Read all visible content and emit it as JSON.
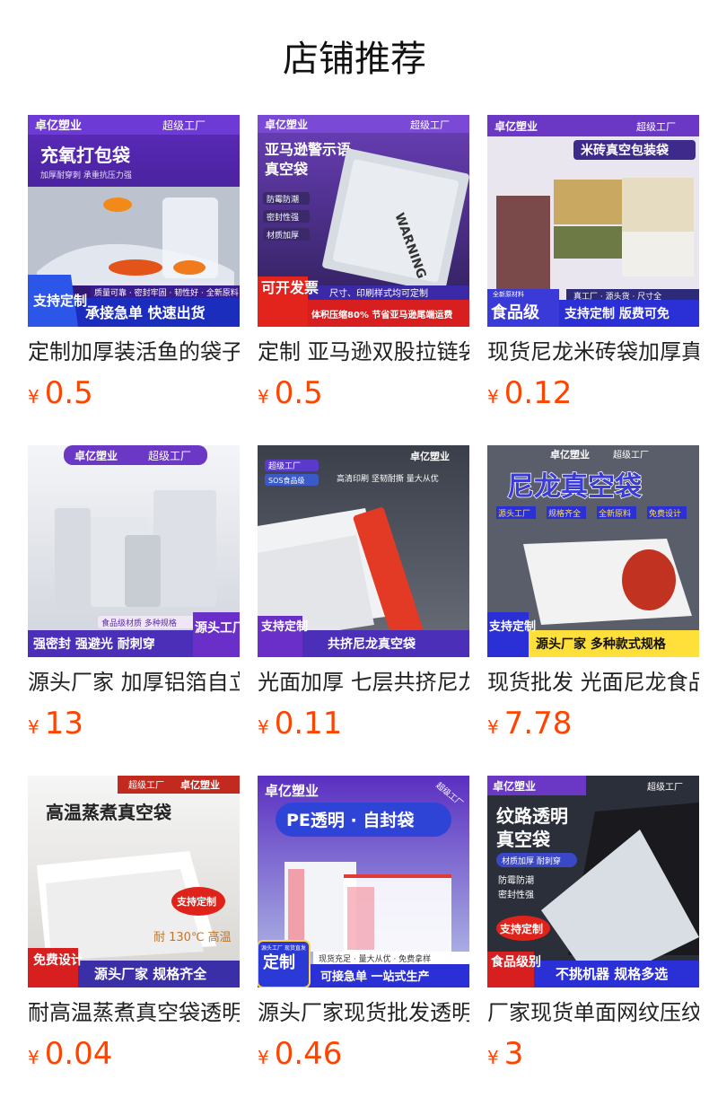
{
  "section": {
    "title": "店铺推荐"
  },
  "colors": {
    "price": "#ff4400",
    "title": "#111111",
    "name": "#222222",
    "banner_blue": "#2b2fd6",
    "banner_purple": "#6b2fc9",
    "badge_red": "#e0231a"
  },
  "products": [
    {
      "name": "定制加厚装活鱼的袋子",
      "currency": "¥",
      "price": "0.5",
      "image": {
        "brand": "卓亿塑业",
        "badge": "超级工厂",
        "headline": "充氧打包袋",
        "subline": "加厚耐穿刺 承重抗压力强",
        "features": "质量可靠 · 密封牢固 · 韧性好 · 全新原料",
        "stamp": "支持定制",
        "banner": "承接急单 快速出货"
      }
    },
    {
      "name": "定制 亚马逊双股拉链袋",
      "currency": "¥",
      "price": "0.5",
      "image": {
        "brand": "卓亿塑业",
        "badge": "超级工厂",
        "headline": "亚马逊警示语",
        "headline2": "真空袋",
        "tags": [
          "防霉防潮",
          "密封性强",
          "材质加厚"
        ],
        "bag_text": "WARNING",
        "note": "尺寸、印刷样式均可定制",
        "stamp": "可开发票",
        "banner": "体积压缩80% 节省亚马逊尾端运费"
      }
    },
    {
      "name": "现货尼龙米砖袋加厚真空袋",
      "currency": "¥",
      "price": "0.12",
      "image": {
        "brand": "卓亿塑业",
        "badge": "超级工厂",
        "headline": "米砖真空包装袋",
        "note": "真工厂 · 源头货 · 尺寸全",
        "stamp_small": "全新原材料",
        "stamp": "食品级",
        "banner": "支持定制 版费可免"
      }
    },
    {
      "name": "源头厂家 加厚铝箔自立袋",
      "currency": "¥",
      "price": "13",
      "image": {
        "brand": "卓亿塑业",
        "badge": "超级工厂",
        "note": "食品级材质 多种规格",
        "stamp": "源头工厂",
        "banner": "强密封 强避光 耐刺穿"
      }
    },
    {
      "name": "光面加厚 七层共挤尼龙真空袋",
      "currency": "¥",
      "price": "0.11",
      "image": {
        "brand": "卓亿塑业",
        "badge": "超级工厂",
        "badge2": "SOS食品级",
        "features": "高清印刷  坚韧耐撕  量大从优",
        "stamp": "支持定制",
        "banner": "共挤尼龙真空袋"
      }
    },
    {
      "name": "现货批发 光面尼龙食品真空袋",
      "currency": "¥",
      "price": "7.78",
      "image": {
        "brand": "卓亿塑业",
        "badge": "超级工厂",
        "headline": "尼龙真空袋",
        "tags": [
          "源头工厂",
          "规格齐全",
          "全新原料",
          "免费设计"
        ],
        "stamp": "支持定制",
        "banner": "源头厂家 多种款式规格"
      }
    },
    {
      "name": "耐高温蒸煮真空袋透明食品袋",
      "currency": "¥",
      "price": "0.04",
      "image": {
        "brand": "卓亿塑业",
        "badge": "超级工厂",
        "headline": "高温蒸煮真空袋",
        "note": "支持定制",
        "temp": "耐 130℃ 高温",
        "stamp": "免费设计",
        "banner": "源头厂家 规格齐全"
      }
    },
    {
      "name": "源头厂家现货批发透明自封袋",
      "currency": "¥",
      "price": "0.46",
      "image": {
        "brand": "卓亿塑业",
        "badge": "超级工厂",
        "headline": "PE透明 · 自封袋",
        "note": "现货充足 · 量大从优 · 免费拿样",
        "stamp": "定制",
        "stamp_small": "源头工厂 现货直发",
        "banner": "可接急单  一站式生产"
      }
    },
    {
      "name": "厂家现货单面网纹压纹真空袋",
      "currency": "¥",
      "price": "3",
      "image": {
        "brand": "卓亿塑业",
        "badge": "超级工厂",
        "headline": "纹路透明",
        "headline2": "真空袋",
        "subline": "材质加厚 耐刺穿",
        "tags": [
          "防霉防潮",
          "密封性强"
        ],
        "note": "支持定制",
        "stamp": "食品级别",
        "banner": "不挑机器 规格多选"
      }
    }
  ]
}
